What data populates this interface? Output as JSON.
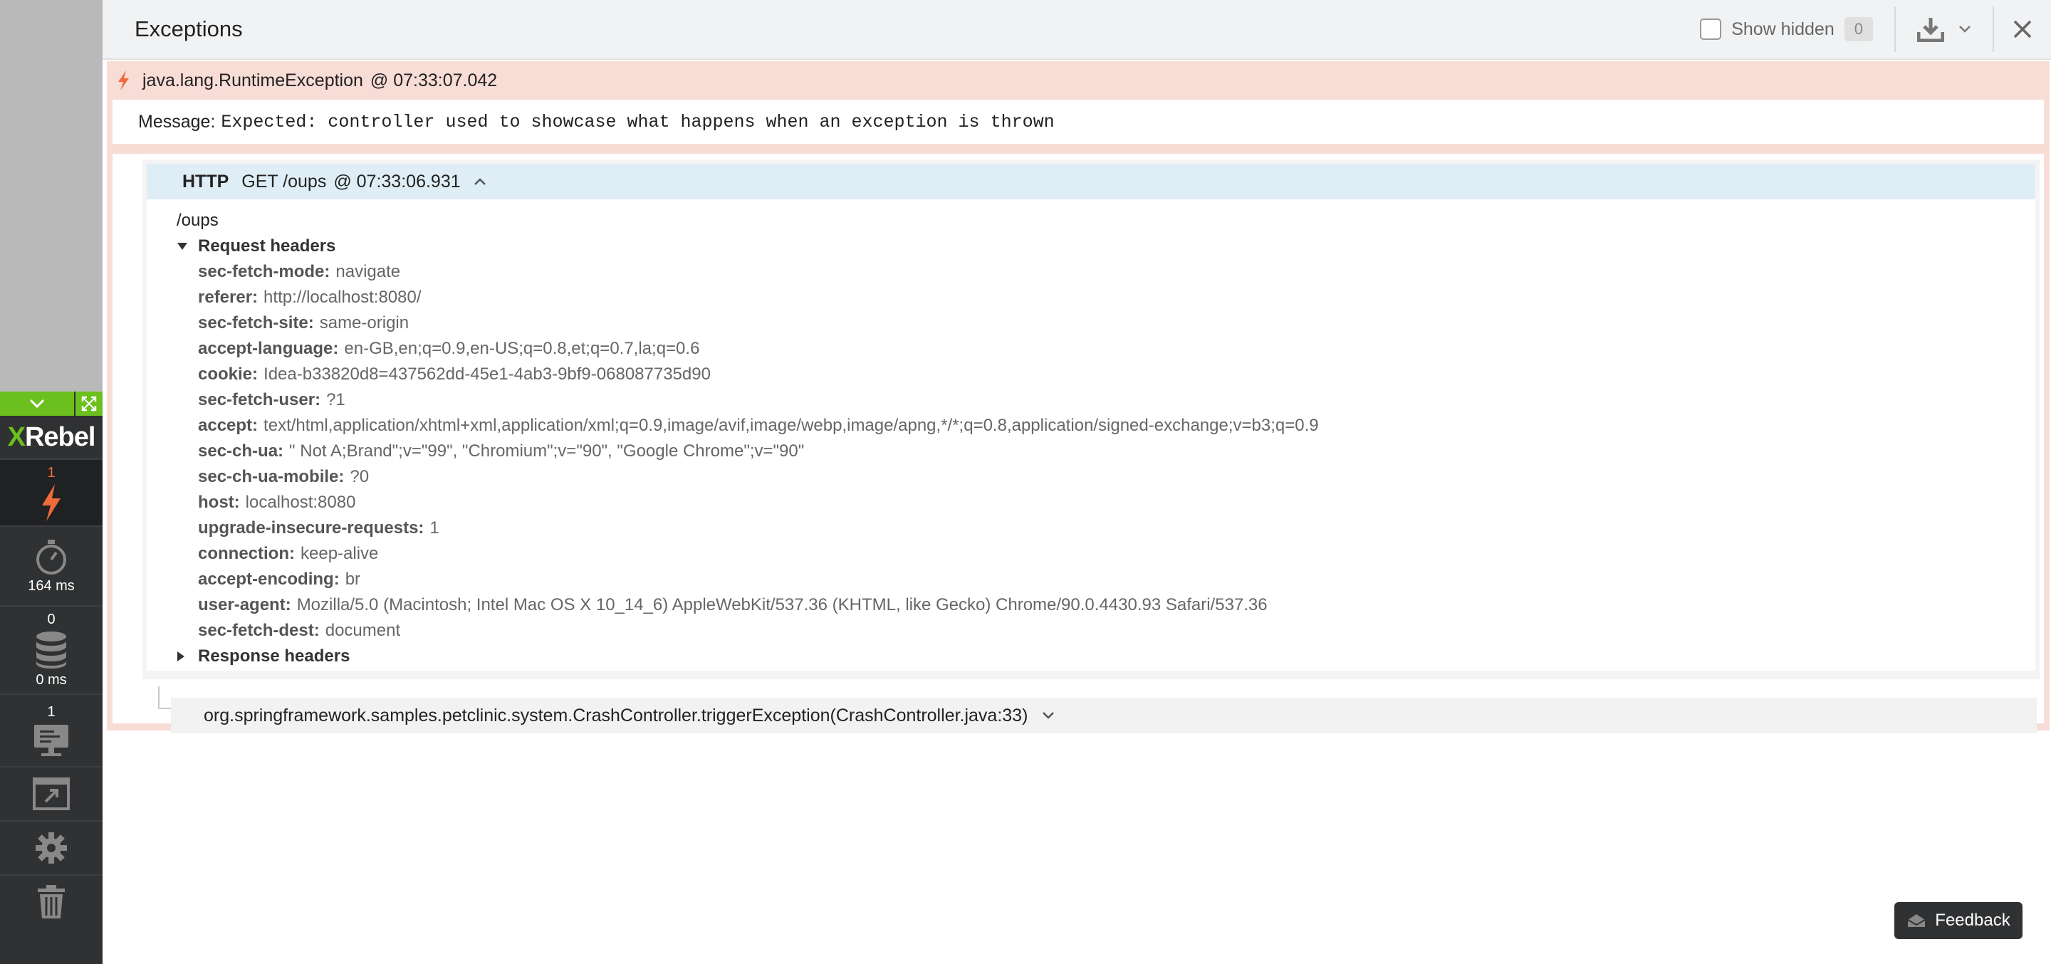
{
  "header": {
    "title": "Exceptions",
    "show_hidden_label": "Show hidden",
    "hidden_count": "0"
  },
  "sidebar": {
    "logo_x": "X",
    "logo_rest": "Rebel",
    "items": [
      {
        "name": "exceptions",
        "count": "1",
        "icon": "lightning-icon"
      },
      {
        "name": "timing",
        "value": "164 ms",
        "icon": "stopwatch-icon"
      },
      {
        "name": "database",
        "count": "0",
        "value": "0 ms",
        "icon": "database-icon"
      },
      {
        "name": "requests",
        "count": "1",
        "icon": "monitor-icon"
      },
      {
        "name": "popout",
        "icon": "popout-icon"
      },
      {
        "name": "settings",
        "icon": "gear-icon"
      },
      {
        "name": "delete",
        "icon": "trash-icon"
      }
    ]
  },
  "exception": {
    "class_name": "java.lang.RuntimeException",
    "time": "@ 07:33:07.042",
    "message_label": "Message:",
    "message": "Expected: controller used to showcase what happens when an exception is thrown"
  },
  "http": {
    "protocol": "HTTP",
    "request": "GET /oups",
    "time": "@ 07:33:06.931",
    "path": "/oups",
    "request_headers_label": "Request headers",
    "response_headers_label": "Response headers",
    "headers": [
      {
        "key": "sec-fetch-mode:",
        "value": "navigate"
      },
      {
        "key": "referer:",
        "value": "http://localhost:8080/"
      },
      {
        "key": "sec-fetch-site:",
        "value": "same-origin"
      },
      {
        "key": "accept-language:",
        "value": "en-GB,en;q=0.9,en-US;q=0.8,et;q=0.7,la;q=0.6"
      },
      {
        "key": "cookie:",
        "value": "Idea-b33820d8=437562dd-45e1-4ab3-9bf9-068087735d90"
      },
      {
        "key": "sec-fetch-user:",
        "value": "?1"
      },
      {
        "key": "accept:",
        "value": "text/html,application/xhtml+xml,application/xml;q=0.9,image/avif,image/webp,image/apng,*/*;q=0.8,application/signed-exchange;v=b3;q=0.9"
      },
      {
        "key": "sec-ch-ua:",
        "value": "\" Not A;Brand\";v=\"99\", \"Chromium\";v=\"90\", \"Google Chrome\";v=\"90\""
      },
      {
        "key": "sec-ch-ua-mobile:",
        "value": "?0"
      },
      {
        "key": "host:",
        "value": "localhost:8080"
      },
      {
        "key": "upgrade-insecure-requests:",
        "value": "1"
      },
      {
        "key": "connection:",
        "value": "keep-alive"
      },
      {
        "key": "accept-encoding:",
        "value": "br"
      },
      {
        "key": "user-agent:",
        "value": "Mozilla/5.0 (Macintosh; Intel Mac OS X 10_14_6) AppleWebKit/537.36 (KHTML, like Gecko) Chrome/90.0.4430.93 Safari/537.36"
      },
      {
        "key": "sec-fetch-dest:",
        "value": "document"
      }
    ]
  },
  "stack": {
    "frame": "org.springframework.samples.petclinic.system.CrashController.triggerException(CrashController.java:33)"
  },
  "feedback_label": "Feedback",
  "colors": {
    "accent_green": "#6cc01e",
    "exception_orange": "#f06a3a",
    "exception_bg": "#f8dcd6",
    "http_header_bg": "#dfeef6",
    "sidebar_bg": "#2f3133"
  }
}
